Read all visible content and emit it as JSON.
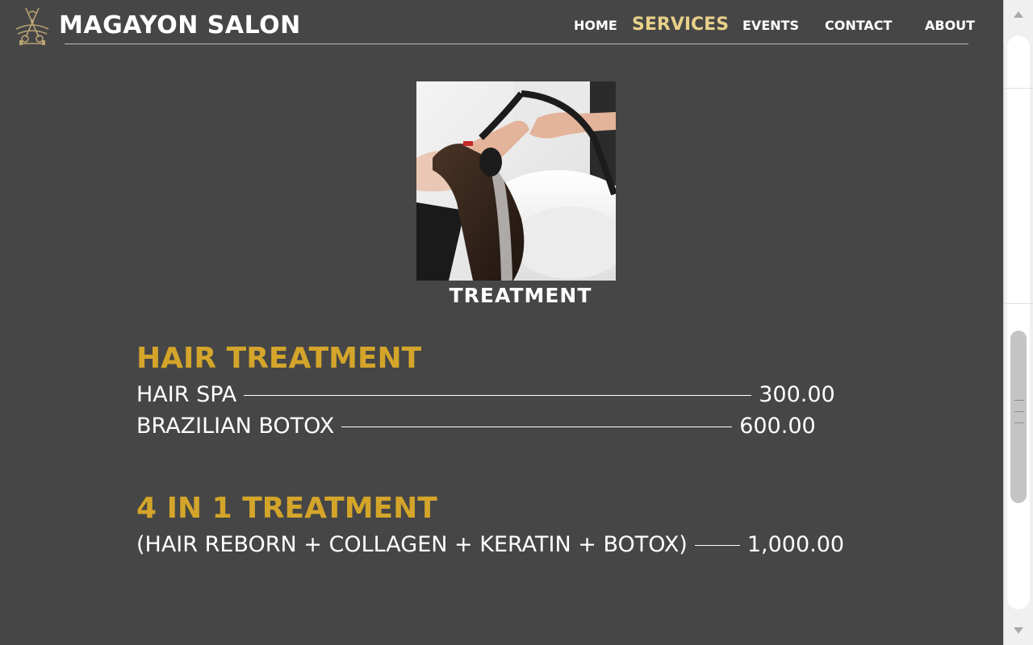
{
  "header": {
    "brand": "MAGAYON SALON",
    "logo_icon": "scissors-comb-ornament-icon",
    "nav": [
      {
        "label": "HOME",
        "active": false
      },
      {
        "label": "SERVICES",
        "active": true
      },
      {
        "label": "EVENTS",
        "active": false
      },
      {
        "label": "CONTACT",
        "active": false
      },
      {
        "label": "ABOUT",
        "active": false
      }
    ]
  },
  "hero": {
    "image_icon": "hair-washing-photo",
    "caption": "TREATMENT"
  },
  "sections": [
    {
      "title": "HAIR TREATMENT",
      "items": [
        {
          "name": "HAIR SPA",
          "price": "300.00"
        },
        {
          "name": "BRAZILIAN BOTOX",
          "price": "600.00"
        }
      ]
    },
    {
      "title": "4 IN 1 TREATMENT",
      "items": [
        {
          "name": "(HAIR REBORN + COLLAGEN + KERATIN + BOTOX)",
          "price": "1,000.00"
        }
      ]
    }
  ],
  "colors": {
    "background": "#464646",
    "accent_gold": "#d4a52a",
    "nav_active": "#e8d08a",
    "text": "#ffffff"
  },
  "scrollbar": {
    "up_icon": "scroll-up-arrow-icon",
    "down_icon": "scroll-down-arrow-icon"
  }
}
